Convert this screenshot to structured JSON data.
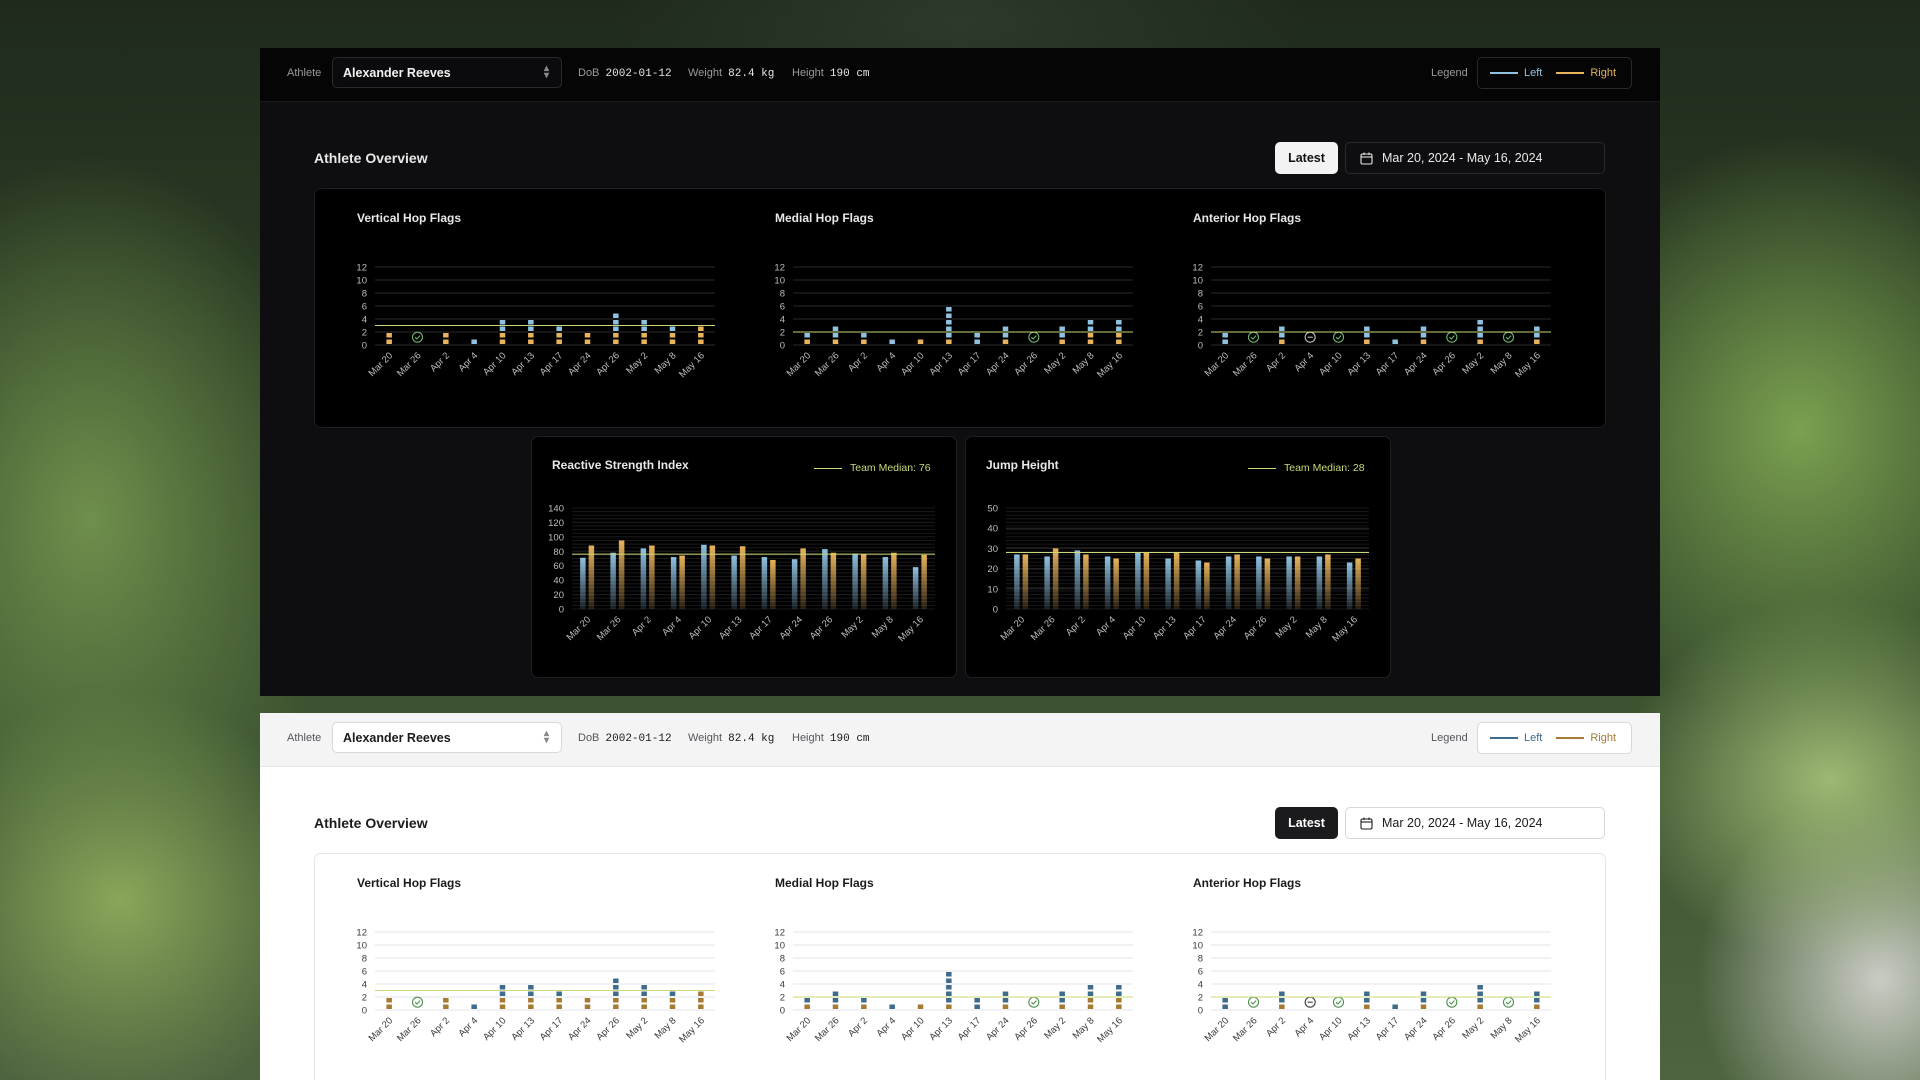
{
  "athlete_label": "Athlete",
  "athlete_name": "Alexander Reeves",
  "dob_label": "DoB",
  "dob": "2002-01-12",
  "weight_label": "Weight",
  "weight": "82.4 kg",
  "height_label": "Height",
  "height": "190 cm",
  "legend_label": "Legend",
  "legend_left": "Left",
  "legend_right": "Right",
  "title": "Athlete Overview",
  "latest": "Latest",
  "date_range": "Mar 20, 2024 - May 16, 2024",
  "colors": {
    "left": "#8fc2e0",
    "right": "#e8b35a",
    "left_light": "#3f6b8c",
    "right_light": "#a57a32",
    "median": "#c9d978"
  },
  "icons": {
    "calendar": "calendar-icon",
    "chevron": "chevron-updown-icon",
    "check": "check-circle-icon",
    "minus": "minus-circle-icon"
  },
  "chart_data": [
    {
      "type": "bar",
      "title": "Vertical Hop Flags",
      "categories": [
        "Mar 20",
        "Mar 26",
        "Apr 2",
        "Apr 4",
        "Apr 10",
        "Apr 13",
        "Apr 17",
        "Apr 24",
        "Apr 26",
        "May 2",
        "May 8",
        "May 16"
      ],
      "series": [
        {
          "name": "Left",
          "values": [
            0,
            0,
            0,
            1,
            2,
            2,
            1,
            0,
            3,
            2,
            1,
            0
          ]
        },
        {
          "name": "Right",
          "values": [
            2,
            0,
            2,
            0,
            2,
            2,
            2,
            2,
            2,
            2,
            2,
            3
          ]
        }
      ],
      "ok_markers": [
        1
      ],
      "ylim": [
        0,
        12
      ],
      "yticks": [
        0,
        2,
        4,
        6,
        8,
        10,
        12
      ],
      "median": 3
    },
    {
      "type": "bar",
      "title": "Medial Hop Flags",
      "categories": [
        "Mar 20",
        "Mar 26",
        "Apr 2",
        "Apr 4",
        "Apr 10",
        "Apr 13",
        "Apr 17",
        "Apr 24",
        "Apr 26",
        "May 2",
        "May 8",
        "May 16"
      ],
      "series": [
        {
          "name": "Left",
          "values": [
            1,
            2,
            1,
            1,
            0,
            5,
            2,
            2,
            0,
            2,
            2,
            2
          ]
        },
        {
          "name": "Right",
          "values": [
            1,
            1,
            1,
            0,
            1,
            1,
            0,
            1,
            0,
            1,
            2,
            2
          ]
        }
      ],
      "ok_markers": [
        8
      ],
      "ylim": [
        0,
        12
      ],
      "yticks": [
        0,
        2,
        4,
        6,
        8,
        10,
        12
      ],
      "median": 2
    },
    {
      "type": "bar",
      "title": "Anterior Hop Flags",
      "categories": [
        "Mar 20",
        "Mar 26",
        "Apr 2",
        "Apr 4",
        "Apr 10",
        "Apr 13",
        "Apr 17",
        "Apr 24",
        "Apr 26",
        "May 2",
        "May 8",
        "May 16"
      ],
      "series": [
        {
          "name": "Left",
          "values": [
            2,
            0,
            2,
            0,
            0,
            2,
            1,
            2,
            0,
            3,
            0,
            2
          ]
        },
        {
          "name": "Right",
          "values": [
            0,
            0,
            1,
            0,
            0,
            1,
            0,
            1,
            0,
            1,
            0,
            1
          ]
        }
      ],
      "ok_markers": [
        1,
        4,
        8,
        10
      ],
      "minus_markers": [
        3
      ],
      "ylim": [
        0,
        12
      ],
      "yticks": [
        0,
        2,
        4,
        6,
        8,
        10,
        12
      ],
      "median": 2
    },
    {
      "type": "bar",
      "title": "Reactive Strength Index",
      "categories": [
        "Mar 20",
        "Mar 26",
        "Apr 2",
        "Apr 4",
        "Apr 10",
        "Apr 13",
        "Apr 17",
        "Apr 24",
        "Apr 26",
        "May 2",
        "May 8",
        "May 16"
      ],
      "series": [
        {
          "name": "Left",
          "values": [
            71,
            78,
            84,
            72,
            89,
            74,
            72,
            69,
            83,
            77,
            72,
            58
          ]
        },
        {
          "name": "Right",
          "values": [
            88,
            95,
            88,
            74,
            88,
            87,
            68,
            84,
            78,
            76,
            78,
            75
          ]
        }
      ],
      "ylim": [
        0,
        140
      ],
      "yticks": [
        0,
        20,
        40,
        60,
        80,
        100,
        120,
        140
      ],
      "median": 76,
      "median_label": "Team Median: 76"
    },
    {
      "type": "bar",
      "title": "Jump Height",
      "categories": [
        "Mar 20",
        "Mar 26",
        "Apr 2",
        "Apr 4",
        "Apr 10",
        "Apr 13",
        "Apr 17",
        "Apr 24",
        "Apr 26",
        "May 2",
        "May 8",
        "May 16"
      ],
      "series": [
        {
          "name": "Left",
          "values": [
            27,
            26,
            29,
            26,
            28,
            25,
            24,
            26,
            26,
            26,
            26,
            23
          ]
        },
        {
          "name": "Right",
          "values": [
            27,
            30,
            27,
            25,
            28,
            28,
            23,
            27,
            25,
            26,
            27,
            25
          ]
        }
      ],
      "ylim": [
        0,
        50
      ],
      "yticks": [
        0,
        10,
        20,
        30,
        40,
        50
      ],
      "median": 28,
      "median_label": "Team Median: 28"
    }
  ]
}
